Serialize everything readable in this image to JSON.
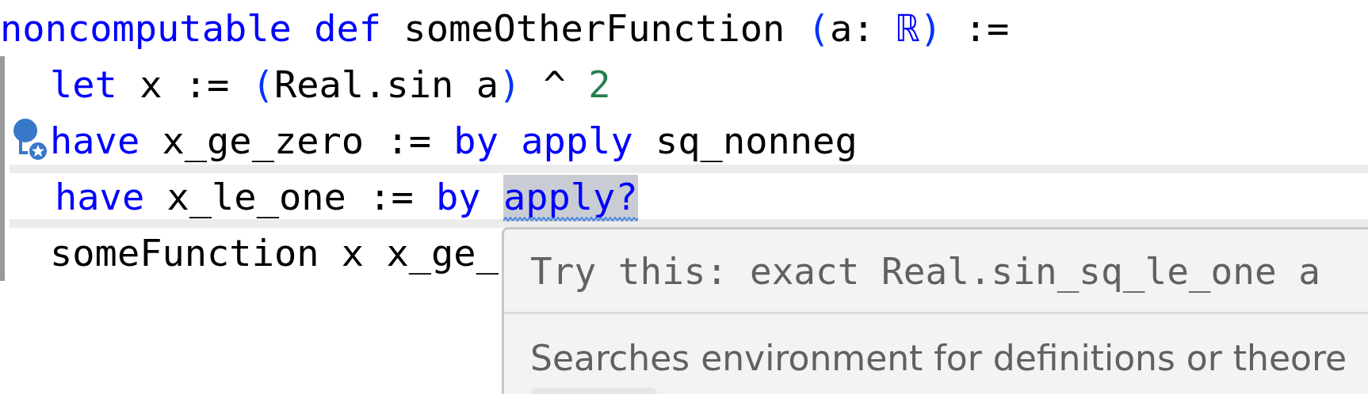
{
  "editor": {
    "lines": [
      {
        "indented": false,
        "current": false,
        "lightbulb": false,
        "tokens": [
          {
            "text": "noncomputable def ",
            "kind": "keyword"
          },
          {
            "text": "someOtherFunction ",
            "kind": "plain"
          },
          {
            "text": "(",
            "kind": "paren"
          },
          {
            "text": "a: ",
            "kind": "plain"
          },
          {
            "text": "ℝ",
            "kind": "keyword"
          },
          {
            "text": ")",
            "kind": "paren"
          },
          {
            "text": " :=",
            "kind": "plain"
          }
        ]
      },
      {
        "indented": true,
        "current": false,
        "lightbulb": false,
        "tokens": [
          {
            "text": "let ",
            "kind": "keyword"
          },
          {
            "text": "x := ",
            "kind": "plain"
          },
          {
            "text": "(",
            "kind": "paren"
          },
          {
            "text": "Real.sin a",
            "kind": "plain"
          },
          {
            "text": ")",
            "kind": "paren"
          },
          {
            "text": " ^ ",
            "kind": "plain"
          },
          {
            "text": "2",
            "kind": "number"
          }
        ]
      },
      {
        "indented": true,
        "current": false,
        "lightbulb": true,
        "tokens": [
          {
            "text": "have ",
            "kind": "keyword"
          },
          {
            "text": "x_ge_zero := ",
            "kind": "plain"
          },
          {
            "text": "by apply ",
            "kind": "keyword"
          },
          {
            "text": "sq_nonneg",
            "kind": "plain"
          }
        ]
      },
      {
        "indented": true,
        "current": true,
        "lightbulb": false,
        "tokens": [
          {
            "text": "have ",
            "kind": "keyword"
          },
          {
            "text": "x_le_one := ",
            "kind": "plain"
          },
          {
            "text": "by ",
            "kind": "keyword"
          },
          {
            "text": "apply?",
            "kind": "keyword",
            "selected": true,
            "diagnostic": true
          }
        ]
      },
      {
        "indented": true,
        "current": false,
        "lightbulb": false,
        "tokens": [
          {
            "text": "someFunction x x_ge_",
            "kind": "plain"
          }
        ]
      }
    ]
  },
  "hover_popup": {
    "suggestion": "Try this: exact Real.sin_sq_le_one a",
    "docs": "Searches environment for definitions or theore"
  }
}
